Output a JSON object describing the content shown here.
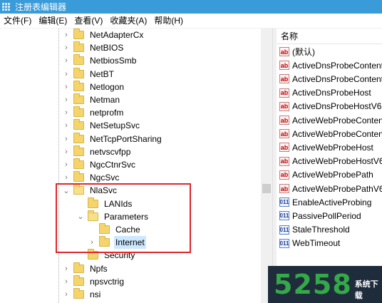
{
  "window": {
    "title": "注册表编辑器"
  },
  "menu": [
    "文件(F)",
    "编辑(E)",
    "查看(V)",
    "收藏夹(A)",
    "帮助(H)"
  ],
  "tree": [
    {
      "label": "NetAdapterCx",
      "level": 1,
      "expander": "collapsed"
    },
    {
      "label": "NetBIOS",
      "level": 1,
      "expander": "collapsed"
    },
    {
      "label": "NetbiosSmb",
      "level": 1,
      "expander": "collapsed"
    },
    {
      "label": "NetBT",
      "level": 1,
      "expander": "collapsed"
    },
    {
      "label": "Netlogon",
      "level": 1,
      "expander": "collapsed"
    },
    {
      "label": "Netman",
      "level": 1,
      "expander": "collapsed"
    },
    {
      "label": "netprofm",
      "level": 1,
      "expander": "collapsed"
    },
    {
      "label": "NetSetupSvc",
      "level": 1,
      "expander": "collapsed"
    },
    {
      "label": "NetTcpPortSharing",
      "level": 1,
      "expander": "collapsed"
    },
    {
      "label": "netvscvfpp",
      "level": 1,
      "expander": "collapsed"
    },
    {
      "label": "NgcCtnrSvc",
      "level": 1,
      "expander": "collapsed"
    },
    {
      "label": "NgcSvc",
      "level": 1,
      "expander": "collapsed"
    },
    {
      "label": "NlaSvc",
      "level": 1,
      "expander": "expanded"
    },
    {
      "label": "LANIds",
      "level": 2,
      "expander": "none"
    },
    {
      "label": "Parameters",
      "level": 2,
      "expander": "expanded"
    },
    {
      "label": "Cache",
      "level": 3,
      "expander": "none"
    },
    {
      "label": "Internet",
      "level": 3,
      "expander": "collapsed",
      "selected": true
    },
    {
      "label": "Security",
      "level": 2,
      "expander": "none"
    },
    {
      "label": "Npfs",
      "level": 1,
      "expander": "collapsed"
    },
    {
      "label": "npsvctrig",
      "level": 1,
      "expander": "collapsed"
    },
    {
      "label": "nsi",
      "level": 1,
      "expander": "collapsed"
    }
  ],
  "values_header": "名称",
  "values": [
    {
      "name": "(默认)",
      "type": "string"
    },
    {
      "name": "ActiveDnsProbeContent",
      "type": "string"
    },
    {
      "name": "ActiveDnsProbeContentV",
      "type": "string"
    },
    {
      "name": "ActiveDnsProbeHost",
      "type": "string"
    },
    {
      "name": "ActiveDnsProbeHostV6",
      "type": "string"
    },
    {
      "name": "ActiveWebProbeContent",
      "type": "string"
    },
    {
      "name": "ActiveWebProbeContent",
      "type": "string"
    },
    {
      "name": "ActiveWebProbeHost",
      "type": "string"
    },
    {
      "name": "ActiveWebProbeHostV6",
      "type": "string"
    },
    {
      "name": "ActiveWebProbePath",
      "type": "string"
    },
    {
      "name": "ActiveWebProbePathV6",
      "type": "string"
    },
    {
      "name": "EnableActiveProbing",
      "type": "dword"
    },
    {
      "name": "PassivePollPeriod",
      "type": "dword"
    },
    {
      "name": "StaleThreshold",
      "type": "dword"
    },
    {
      "name": "WebTimeout",
      "type": "dword"
    }
  ],
  "icons": {
    "string_value": "ab",
    "dword_value": "011"
  },
  "watermark": {
    "digits": "5258",
    "text": "系统下载"
  },
  "colors": {
    "titlebar": "#3a9bd9",
    "highlight": "#e0262b",
    "selection": "#cce8ff",
    "folder": "#f5d46b"
  }
}
